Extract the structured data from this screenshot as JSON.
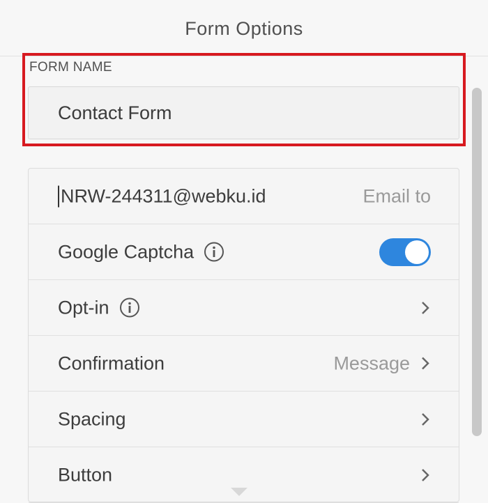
{
  "header": {
    "title": "Form Options"
  },
  "form_name": {
    "label": "FORM NAME",
    "value": "Contact Form"
  },
  "rows": {
    "email": {
      "value": "NRW-244311@webku.id",
      "placeholder": "Email to"
    },
    "captcha": {
      "label": "Google Captcha",
      "toggle_on": true
    },
    "optin": {
      "label": "Opt-in"
    },
    "confirmation": {
      "label": "Confirmation",
      "value": "Message"
    },
    "spacing": {
      "label": "Spacing"
    },
    "button": {
      "label": "Button"
    }
  },
  "colors": {
    "accent": "#2e86de",
    "highlight": "#d71a20"
  },
  "icons": {
    "info": "info-icon",
    "chevron": "chevron-right-icon"
  }
}
